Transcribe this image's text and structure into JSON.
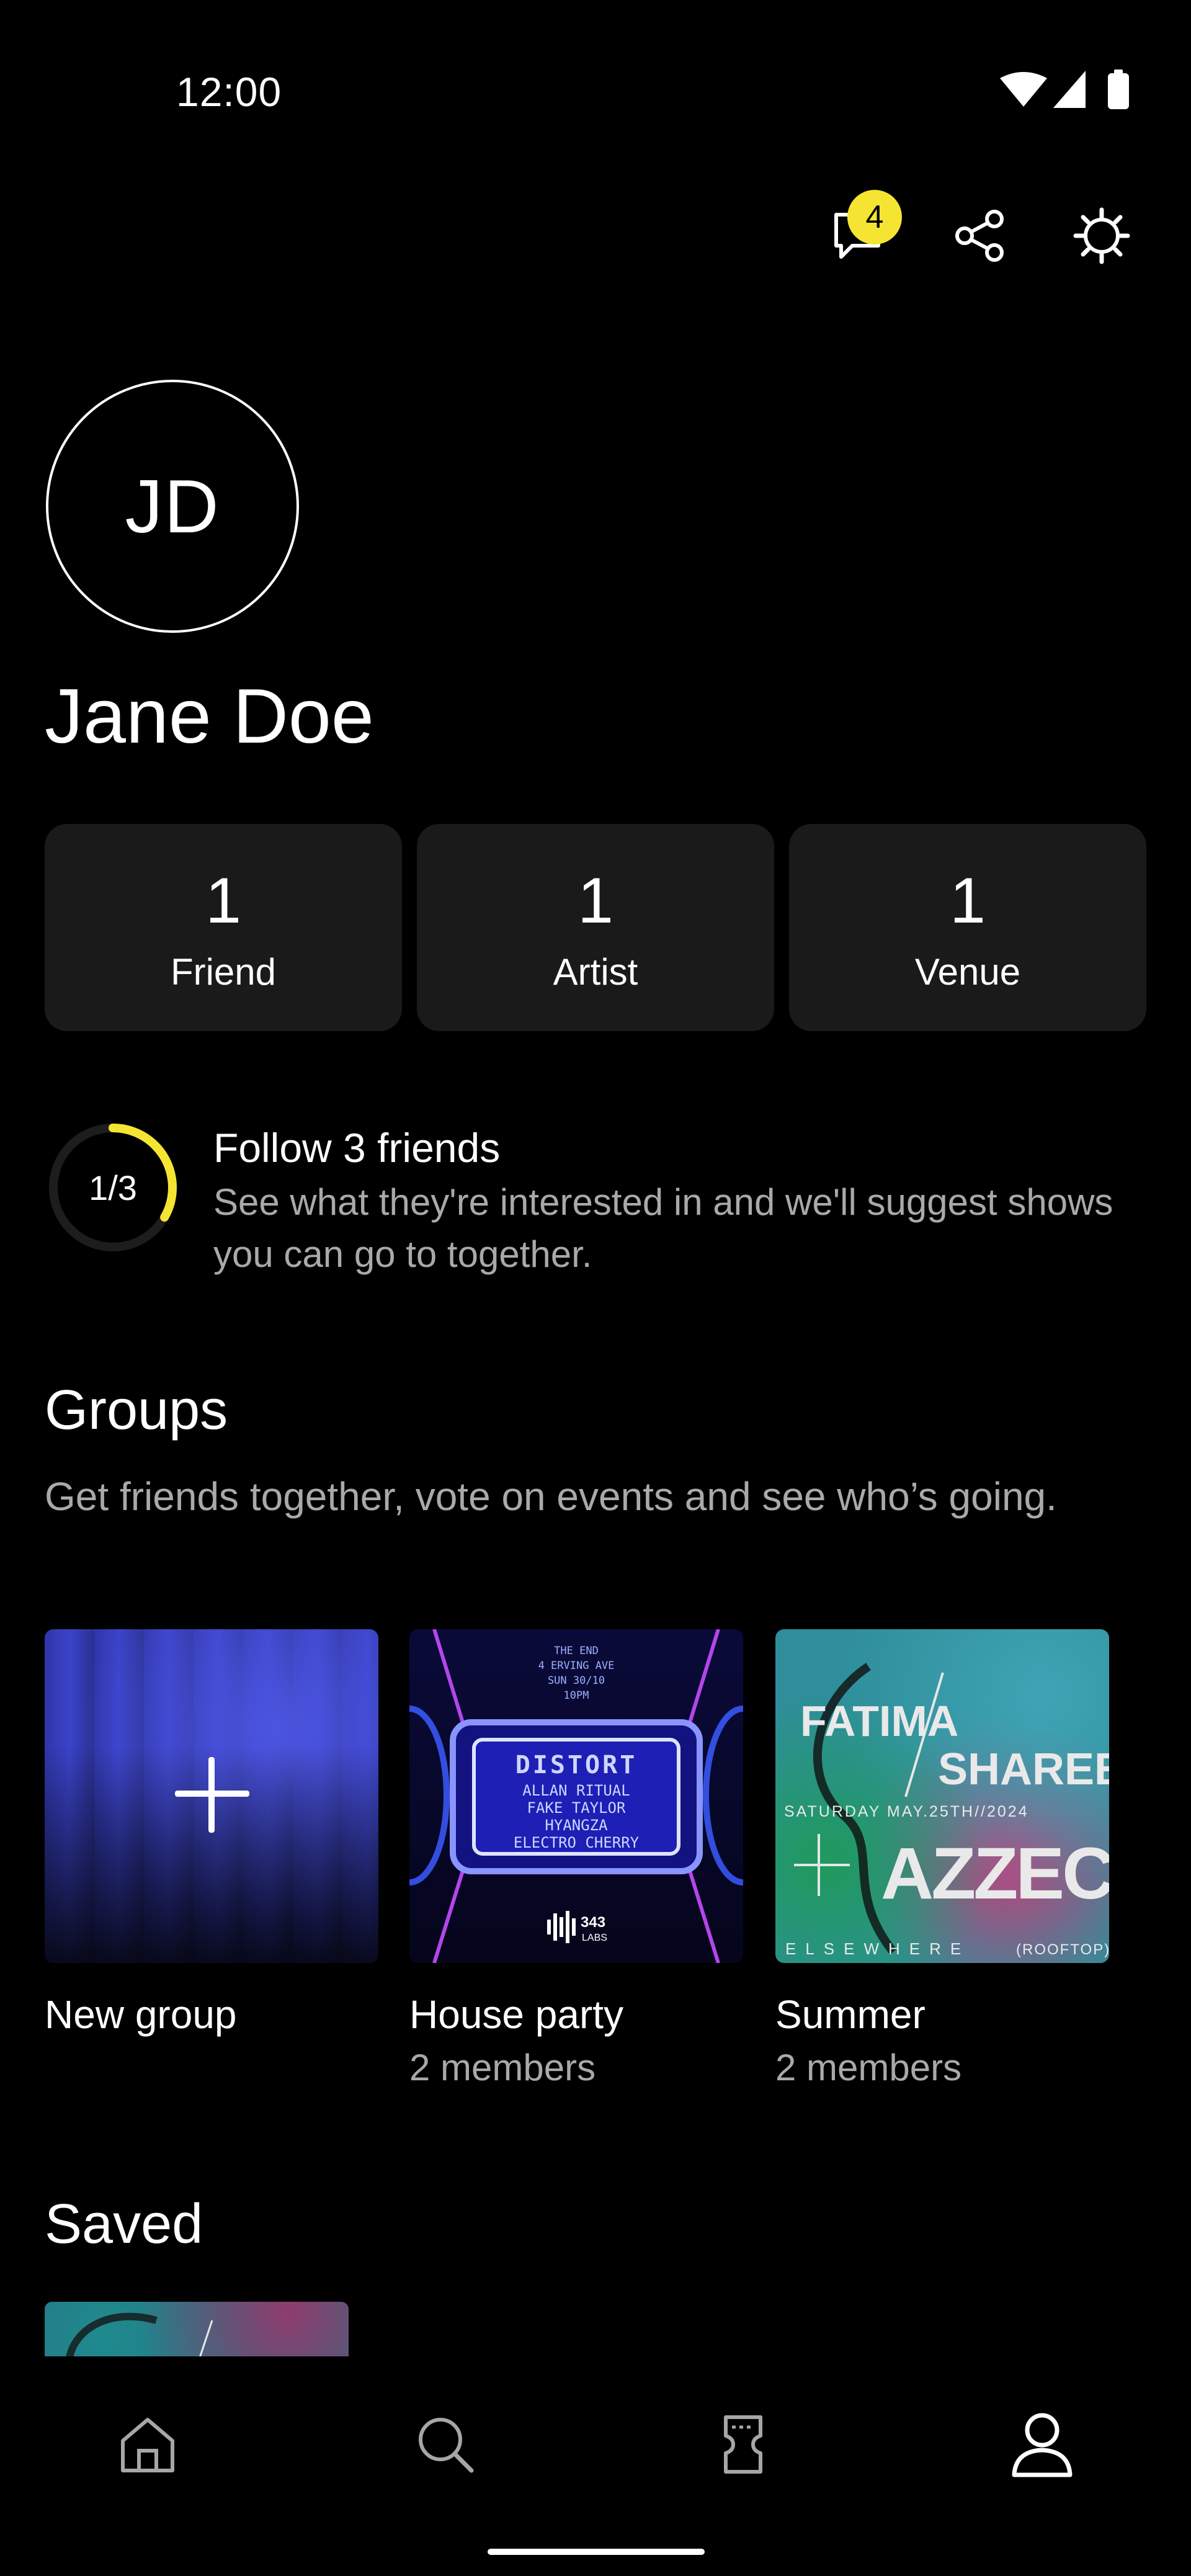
{
  "status_bar": {
    "time": "12:00",
    "icons": [
      "wifi-icon",
      "cellular-signal-icon",
      "battery-icon"
    ]
  },
  "header_actions": {
    "notifications": {
      "icon": "chat-bubble-icon",
      "badge_count": "4"
    },
    "share": {
      "icon": "share-icon"
    },
    "settings": {
      "icon": "gear-icon"
    }
  },
  "profile": {
    "initials": "JD",
    "name": "Jane Doe"
  },
  "stats": [
    {
      "value": "1",
      "label": "Friend"
    },
    {
      "value": "1",
      "label": "Artist"
    },
    {
      "value": "1",
      "label": "Venue"
    }
  ],
  "progress": {
    "text": "1/3",
    "fraction": 0.3333,
    "title": "Follow 3 friends",
    "description": "See what they're interested in and we'll suggest shows you can go to together."
  },
  "groups": {
    "title": "Groups",
    "description": "Get friends together, vote on events and see who’s going.",
    "items": [
      {
        "name": "New group",
        "members": "",
        "icon": "plus-icon"
      },
      {
        "name": "House party",
        "members": "2 members",
        "poster": {
          "top_lines": [
            "THE END",
            "4 ERVING AVE",
            "SUN 30/10",
            "10PM"
          ],
          "headline": "DISTORT",
          "artists": [
            "ALLAN RITUAL",
            "FAKE TAYLOR",
            "HYANGZA",
            "ELECTRO CHERRY"
          ],
          "brand_number": "343",
          "brand_name": "LABS"
        }
      },
      {
        "name": "Summer",
        "members": "2 members",
        "poster": {
          "artist_left": "FATIMA",
          "artist_right": "SHAREEN",
          "date": "SATURDAY MAY.25TH//2024",
          "headliner": "AZZECCA",
          "venue": "ELSEWHERE",
          "area": "(ROOFTOP)"
        }
      }
    ]
  },
  "saved": {
    "title": "Saved"
  },
  "bottom_nav": [
    {
      "icon": "home-icon",
      "active": false
    },
    {
      "icon": "search-icon",
      "active": false
    },
    {
      "icon": "ticket-icon",
      "active": false
    },
    {
      "icon": "profile-icon",
      "active": true
    }
  ],
  "colors": {
    "background": "#000000",
    "card": "#1a1a1a",
    "accent_yellow": "#F5E532",
    "secondary_text": "#a9a9a9"
  }
}
